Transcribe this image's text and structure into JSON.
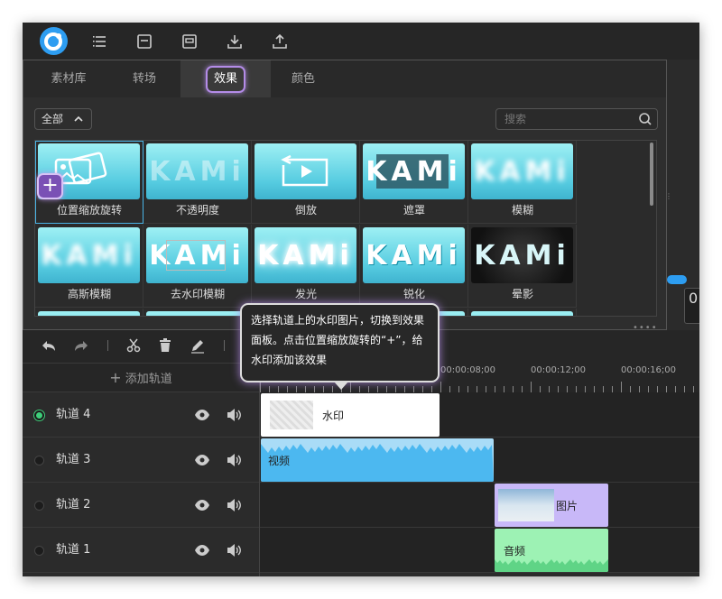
{
  "tabs": [
    "素材库",
    "转场",
    "效果",
    "颜色"
  ],
  "active_tab": "效果",
  "filter": {
    "label": "全部"
  },
  "search": {
    "placeholder": "搜索"
  },
  "effects": [
    {
      "label": "位置缩放旋转",
      "thumb": "picture"
    },
    {
      "label": "不透明度",
      "thumb": "kami-fade"
    },
    {
      "label": "倒放",
      "thumb": "reverse"
    },
    {
      "label": "遮罩",
      "thumb": "kami-mask"
    },
    {
      "label": "模糊",
      "thumb": "kami-blur"
    },
    {
      "label": "高斯模糊",
      "thumb": "kami-blur"
    },
    {
      "label": "去水印模糊",
      "thumb": "kami-watermark"
    },
    {
      "label": "发光",
      "thumb": "kami-glow"
    },
    {
      "label": "锐化",
      "thumb": "kami-sharp"
    },
    {
      "label": "晕影",
      "thumb": "kami-vignette"
    }
  ],
  "thumb_text": "KAMi",
  "toolbar_actions": [
    "undo-icon",
    "redo-icon",
    "cut-icon",
    "delete-icon",
    "edit-icon"
  ],
  "add_track_label": "添加轨道",
  "timecodes": [
    "00:00:08;00",
    "00:00:12;00",
    "00:00:16;00"
  ],
  "tracks": [
    {
      "name": "轨道 4",
      "active": true,
      "clip": {
        "label": "水印",
        "type": "watermark"
      }
    },
    {
      "name": "轨道 3",
      "active": false,
      "clip": {
        "label": "视频",
        "type": "video"
      }
    },
    {
      "name": "轨道 2",
      "active": false,
      "clip": {
        "label": "图片",
        "type": "image"
      }
    },
    {
      "name": "轨道 1",
      "active": false,
      "clip": {
        "label": "音频",
        "type": "audio"
      }
    }
  ],
  "tooltip": "选择轨道上的水印图片，切换到效果面板。点击位置缩放旋转的“+”，给水印添加该效果",
  "side_value": "0",
  "colors": {
    "accent": "#2d9df1",
    "highlight": "#b48ce8",
    "video_clip": "#4cb8f0",
    "image_clip": "#c8b8f8",
    "audio_clip": "#9df2b4",
    "active_dot": "#3ecf7a"
  }
}
